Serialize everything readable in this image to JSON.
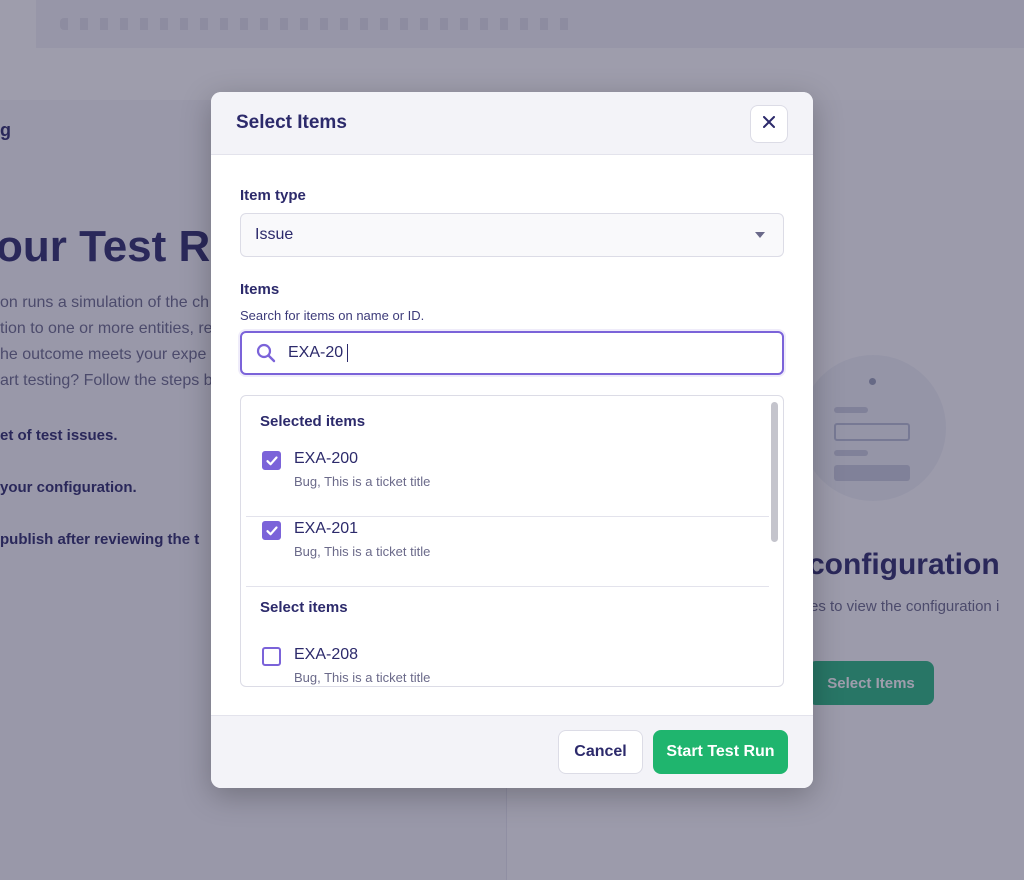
{
  "background": {
    "breadcrumb": "g",
    "title": "our Test Ru",
    "description": [
      "on runs a simulation of the ch",
      "tion to one or more entities, re",
      "he outcome meets your expe",
      "art testing? Follow the steps b"
    ],
    "steps": [
      "et of test issues.",
      "your configuration.",
      "publish after reviewing the t"
    ],
    "config_title": "configuration",
    "config_subtitle": "es to view the configuration i",
    "select_items_button": "Select Items"
  },
  "modal": {
    "title": "Select Items",
    "close_icon": "close-icon",
    "item_type": {
      "label": "Item type",
      "value": "Issue"
    },
    "items": {
      "label": "Items",
      "hint": "Search for items on name or ID.",
      "search_value": "EXA-20",
      "search_icon": "search-icon"
    },
    "selected_section_title": "Selected items",
    "selected_items": [
      {
        "id": "EXA-200",
        "desc": "Bug, This is a ticket title",
        "checked": true
      },
      {
        "id": "EXA-201",
        "desc": "Bug, This is a ticket title",
        "checked": true
      }
    ],
    "select_section_title": "Select items",
    "select_items": [
      {
        "id": "EXA-208",
        "desc": "Bug, This is a ticket title",
        "checked": false
      }
    ],
    "footer": {
      "cancel_label": "Cancel",
      "start_label": "Start Test Run"
    }
  },
  "colors": {
    "accent": "#7b63d9",
    "primary_button": "#1fb56e",
    "heading": "#2c2a6b"
  }
}
